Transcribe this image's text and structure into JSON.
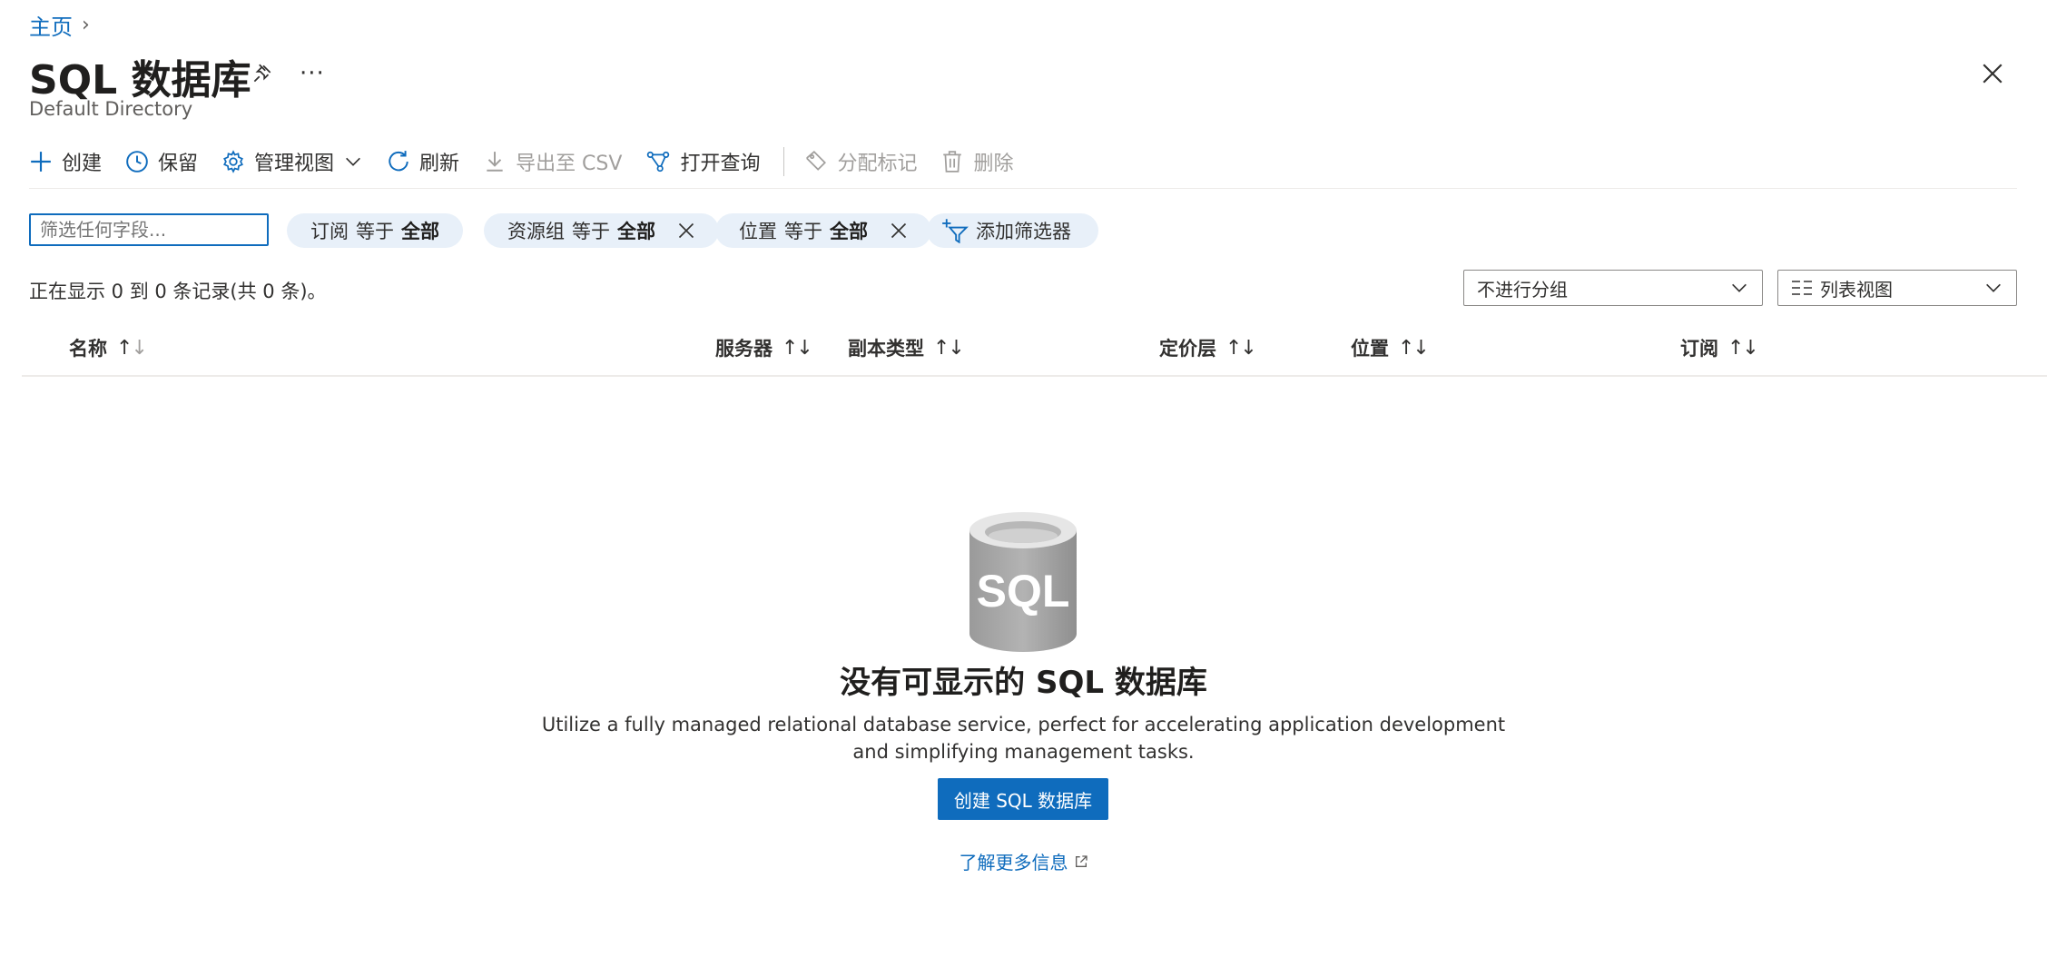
{
  "breadcrumb": {
    "home": "主页"
  },
  "page": {
    "title": "SQL 数据库",
    "subtitle": "Default Directory",
    "more": "···"
  },
  "toolbar": {
    "create": "创建",
    "reservations": "保留",
    "manage_view": "管理视图",
    "refresh": "刷新",
    "export_csv": "导出至 CSV",
    "open_query": "打开查询",
    "assign_tags": "分配标记",
    "delete": "删除"
  },
  "filters": {
    "search_placeholder": "筛选任何字段...",
    "pills": [
      {
        "field": "订阅",
        "op": "等于",
        "value": "全部"
      },
      {
        "field": "资源组",
        "op": "等于",
        "value": "全部"
      },
      {
        "field": "位置",
        "op": "等于",
        "value": "全部"
      }
    ],
    "add_filter": "添加筛选器"
  },
  "records": "正在显示 0 到 0 条记录(共 0 条)。",
  "grouping": {
    "selected": "不进行分组"
  },
  "view": {
    "selected": "列表视图"
  },
  "columns": [
    "名称",
    "服务器",
    "副本类型",
    "定价层",
    "位置",
    "订阅"
  ],
  "empty_state": {
    "icon_text": "SQL",
    "title": "没有可显示的 SQL 数据库",
    "description": "Utilize a fully managed relational database service, perfect for accelerating application development and simplifying management tasks.",
    "create_button": "创建 SQL 数据库",
    "learn_more": "了解更多信息"
  },
  "colors": {
    "accent": "#0f6cbd",
    "pill_bg": "#e8f0f9",
    "disabled": "#a19f9d"
  }
}
